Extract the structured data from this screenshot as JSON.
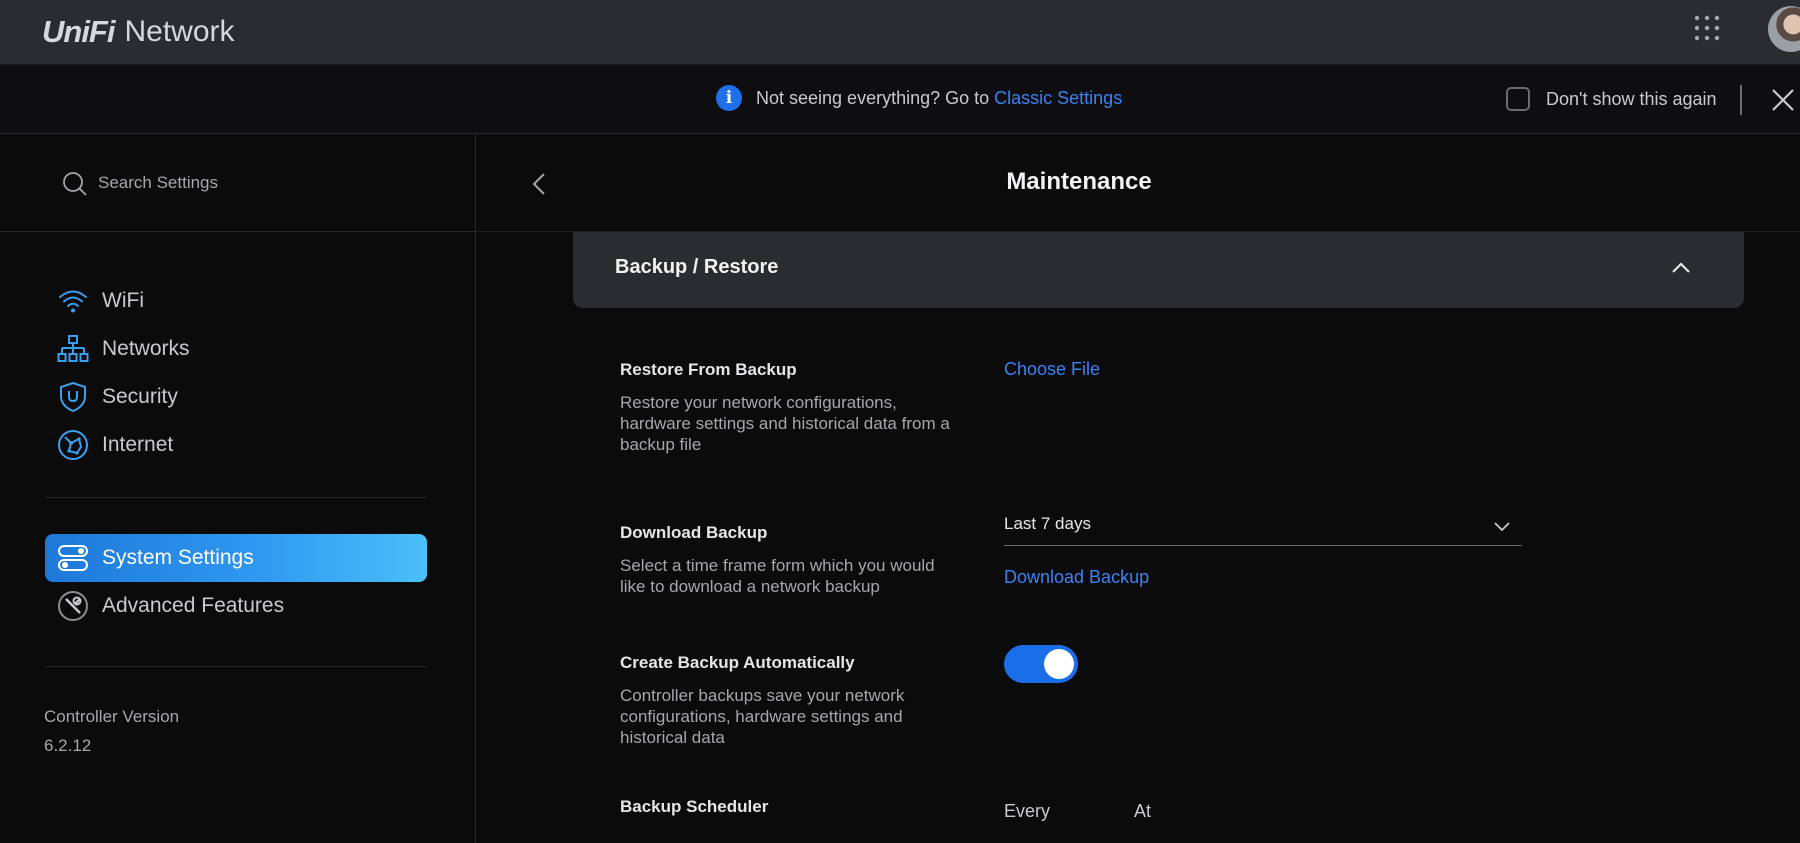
{
  "app": {
    "brand": "UniFi",
    "product": "Network"
  },
  "notice": {
    "text": "Not seeing everything? Go to",
    "link": "Classic Settings",
    "dont_show": "Don't show this again"
  },
  "sidebar": {
    "search_placeholder": "Search Settings",
    "items": [
      {
        "label": "WiFi",
        "icon": "wifi-icon"
      },
      {
        "label": "Networks",
        "icon": "network-topology-icon"
      },
      {
        "label": "Security",
        "icon": "shield-icon"
      },
      {
        "label": "Internet",
        "icon": "globe-icon"
      },
      {
        "label": "System Settings",
        "icon": "toggles-icon",
        "active": true
      },
      {
        "label": "Advanced Features",
        "icon": "tools-icon"
      }
    ],
    "version_label": "Controller Version",
    "version_value": "6.2.12"
  },
  "main": {
    "title": "Maintenance",
    "section_title": "Backup / Restore",
    "restore": {
      "title": "Restore From Backup",
      "desc": "Restore your network configurations, hardware settings and historical data from a backup file",
      "action": "Choose File"
    },
    "download": {
      "title": "Download Backup",
      "desc": "Select a time frame form which you would like to download a network backup",
      "select_value": "Last 7 days",
      "action": "Download Backup"
    },
    "auto": {
      "title": "Create Backup Automatically",
      "desc": "Controller backups save your network configurations, hardware settings and historical data",
      "enabled": true
    },
    "scheduler": {
      "title": "Backup Scheduler",
      "every_label": "Every",
      "at_label": "At"
    }
  },
  "colors": {
    "accent": "#3b82f6",
    "active_gradient_start": "#1e78d8",
    "active_gradient_end": "#4ac0f8",
    "toggle_on": "#1a6ee8"
  }
}
